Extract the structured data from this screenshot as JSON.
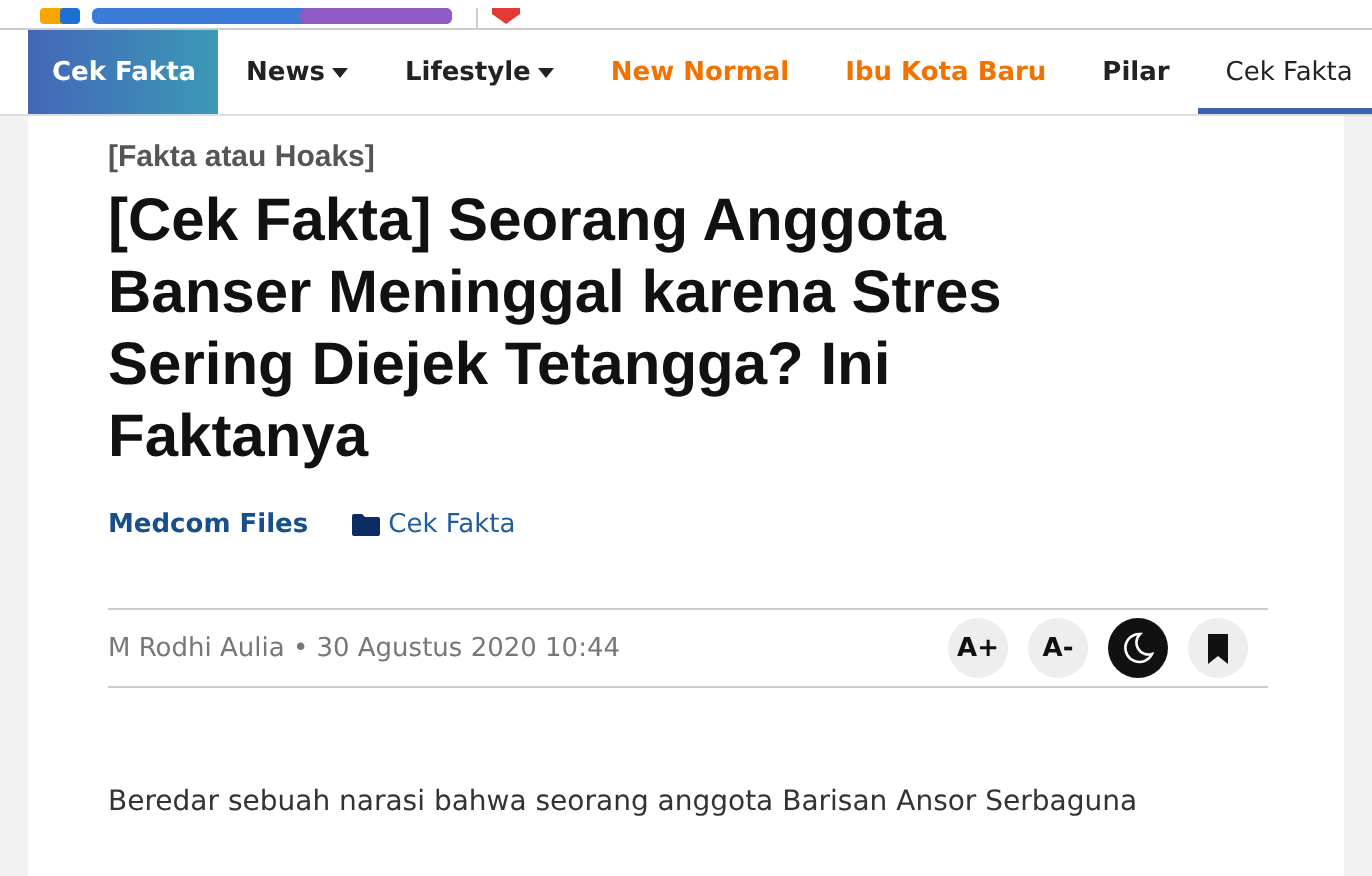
{
  "nav": {
    "brand": "Cek Fakta",
    "items": [
      {
        "label": "News",
        "dropdown": true,
        "highlight": false,
        "selected": false
      },
      {
        "label": "Lifestyle",
        "dropdown": true,
        "highlight": false,
        "selected": false
      },
      {
        "label": "New Normal",
        "dropdown": false,
        "highlight": true,
        "selected": false
      },
      {
        "label": "Ibu Kota Baru",
        "dropdown": false,
        "highlight": true,
        "selected": false
      },
      {
        "label": "Pilar",
        "dropdown": false,
        "highlight": false,
        "selected": false
      },
      {
        "label": "Cek Fakta",
        "dropdown": false,
        "highlight": false,
        "selected": true
      }
    ]
  },
  "article": {
    "category": "[Fakta atau Hoaks]",
    "title": "[Cek Fakta] Seorang Anggota Banser Meninggal karena Stres Sering Diejek Tetangga? Ini Faktanya",
    "source": "Medcom Files",
    "section": "Cek Fakta",
    "byline": "M Rodhi Aulia • 30 Agustus 2020 10:44",
    "tools": [
      {
        "kind": "font-up",
        "label": "A+",
        "on": false
      },
      {
        "kind": "font-down",
        "label": "A-",
        "on": false
      },
      {
        "kind": "dark-mode",
        "on": true
      },
      {
        "kind": "bookmark",
        "on": false
      }
    ],
    "body": "Beredar sebuah narasi bahwa seorang anggota Barisan Ansor Serbaguna"
  }
}
